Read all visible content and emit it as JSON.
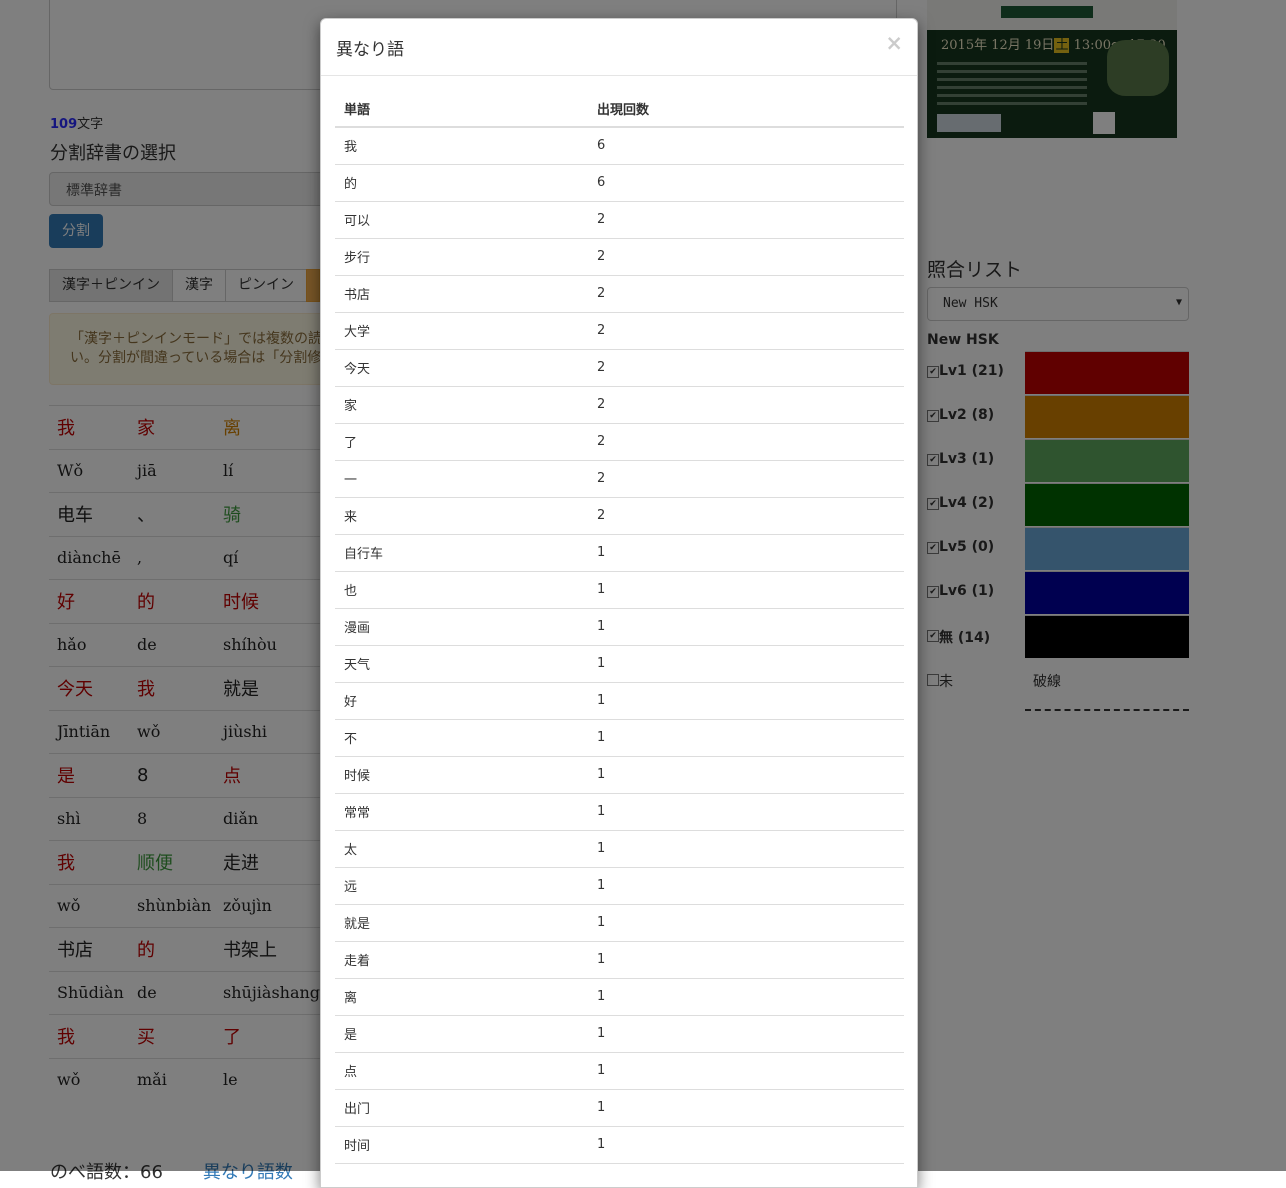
{
  "background": {
    "char_count": "109",
    "char_unit": "文字",
    "dict_label": "分割辞書の選択",
    "dict_selected": "標準辞書",
    "split_button": "分割",
    "modes": [
      "漢字＋ピンイン",
      "漢字",
      "ピンイン"
    ],
    "warning_line1": "「漢字＋ピンインモード」では複数の読",
    "warning_line2": "い。分割が間違っている場合は「分割修",
    "words": [
      [
        {
          "h": "我",
          "p": "Wǒ",
          "c": "lv1"
        },
        {
          "h": "家",
          "p": "jiā",
          "c": "lv1"
        },
        {
          "h": "离",
          "p": "lí",
          "c": "lv2"
        }
      ],
      [
        {
          "h": "电车",
          "p": "diànchē",
          "c": "none"
        },
        {
          "h": "、",
          "p": ",",
          "c": "none"
        },
        {
          "h": "骑",
          "p": "qí",
          "c": "lv3"
        }
      ],
      [
        {
          "h": "好",
          "p": "hǎo",
          "c": "lv1"
        },
        {
          "h": "的",
          "p": "de",
          "c": "lv1"
        },
        {
          "h": "时候",
          "p": "shíhòu",
          "c": "lv1"
        }
      ],
      [
        {
          "h": "今天",
          "p": "Jīntiān",
          "c": "lv1"
        },
        {
          "h": "我",
          "p": "wǒ",
          "c": "lv1"
        },
        {
          "h": "就是",
          "p": "jiùshi",
          "c": "none"
        }
      ],
      [
        {
          "h": "是",
          "p": "shì",
          "c": "lv1"
        },
        {
          "h": "8",
          "p": "8",
          "c": "none"
        },
        {
          "h": "点",
          "p": "diǎn",
          "c": "lv1"
        }
      ],
      [
        {
          "h": "我",
          "p": "wǒ",
          "c": "lv1"
        },
        {
          "h": "顺便",
          "p": "shùnbiàn",
          "c": "lv3"
        },
        {
          "h": "走进",
          "p": "zǒujìn",
          "c": "none"
        }
      ],
      [
        {
          "h": "书店",
          "p": "Shūdiàn",
          "c": "none"
        },
        {
          "h": "的",
          "p": "de",
          "c": "lv1"
        },
        {
          "h": "书架上",
          "p": "shūjiàshang",
          "c": "none"
        }
      ],
      [
        {
          "h": "我",
          "p": "wǒ",
          "c": "lv1"
        },
        {
          "h": "买",
          "p": "mǎi",
          "c": "lv1"
        },
        {
          "h": "了",
          "p": "le",
          "c": "lv1"
        }
      ]
    ],
    "bottom_text": "のべ語数：66",
    "bottom_link": "異なり語数",
    "poster_date": "2015年 12月 19日",
    "poster_day": "土",
    "poster_time": "13:00～ 17:30",
    "match_title": "照合リスト",
    "match_selected": "New HSK",
    "hsk_label": "New HSK",
    "levels": [
      {
        "label": "Lv1 (21)",
        "color": "#c00000",
        "checked": true
      },
      {
        "label": "Lv2 (8)",
        "color": "#d08000",
        "checked": true
      },
      {
        "label": "Lv3 (1)",
        "color": "#5fa85f",
        "checked": true
      },
      {
        "label": "Lv4 (2)",
        "color": "#006400",
        "checked": true
      },
      {
        "label": "Lv5 (0)",
        "color": "#6aa8d8",
        "checked": true
      },
      {
        "label": "Lv6 (1)",
        "color": "#0000a0",
        "checked": true
      },
      {
        "label": "無 (14)",
        "color": "#000000",
        "checked": true
      }
    ],
    "unlisted_label": "未",
    "dashed_label": "破線"
  },
  "modal": {
    "title": "異なり語",
    "close": "×",
    "col_word": "単語",
    "col_count": "出現回数",
    "rows": [
      [
        "我",
        "6"
      ],
      [
        "的",
        "6"
      ],
      [
        "可以",
        "2"
      ],
      [
        "步行",
        "2"
      ],
      [
        "书店",
        "2"
      ],
      [
        "大学",
        "2"
      ],
      [
        "今天",
        "2"
      ],
      [
        "家",
        "2"
      ],
      [
        "了",
        "2"
      ],
      [
        "一",
        "2"
      ],
      [
        "来",
        "2"
      ],
      [
        "自行车",
        "1"
      ],
      [
        "也",
        "1"
      ],
      [
        "漫画",
        "1"
      ],
      [
        "天气",
        "1"
      ],
      [
        "好",
        "1"
      ],
      [
        "不",
        "1"
      ],
      [
        "时候",
        "1"
      ],
      [
        "常常",
        "1"
      ],
      [
        "太",
        "1"
      ],
      [
        "远",
        "1"
      ],
      [
        "就是",
        "1"
      ],
      [
        "走着",
        "1"
      ],
      [
        "离",
        "1"
      ],
      [
        "是",
        "1"
      ],
      [
        "点",
        "1"
      ],
      [
        "出门",
        "1"
      ],
      [
        "时间",
        "1"
      ]
    ]
  }
}
